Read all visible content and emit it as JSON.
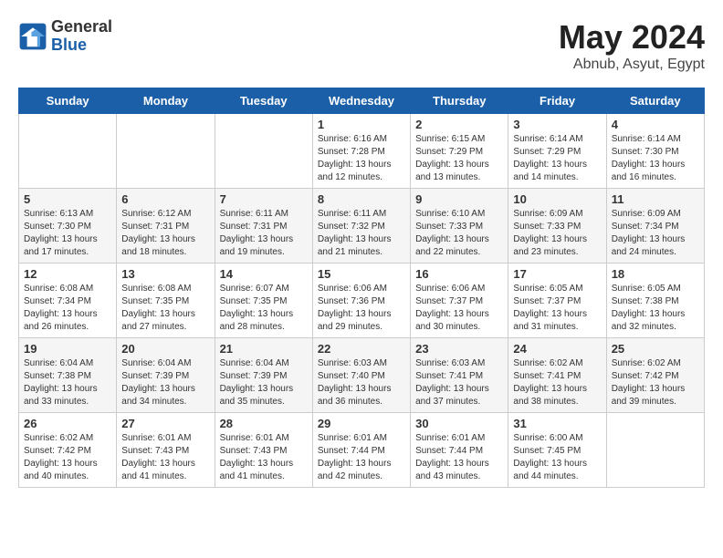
{
  "header": {
    "logo_general": "General",
    "logo_blue": "Blue",
    "month_title": "May 2024",
    "subtitle": "Abnub, Asyut, Egypt"
  },
  "weekdays": [
    "Sunday",
    "Monday",
    "Tuesday",
    "Wednesday",
    "Thursday",
    "Friday",
    "Saturday"
  ],
  "weeks": [
    [
      {
        "day": "",
        "info": ""
      },
      {
        "day": "",
        "info": ""
      },
      {
        "day": "",
        "info": ""
      },
      {
        "day": "1",
        "info": "Sunrise: 6:16 AM\nSunset: 7:28 PM\nDaylight: 13 hours\nand 12 minutes."
      },
      {
        "day": "2",
        "info": "Sunrise: 6:15 AM\nSunset: 7:29 PM\nDaylight: 13 hours\nand 13 minutes."
      },
      {
        "day": "3",
        "info": "Sunrise: 6:14 AM\nSunset: 7:29 PM\nDaylight: 13 hours\nand 14 minutes."
      },
      {
        "day": "4",
        "info": "Sunrise: 6:14 AM\nSunset: 7:30 PM\nDaylight: 13 hours\nand 16 minutes."
      }
    ],
    [
      {
        "day": "5",
        "info": "Sunrise: 6:13 AM\nSunset: 7:30 PM\nDaylight: 13 hours\nand 17 minutes."
      },
      {
        "day": "6",
        "info": "Sunrise: 6:12 AM\nSunset: 7:31 PM\nDaylight: 13 hours\nand 18 minutes."
      },
      {
        "day": "7",
        "info": "Sunrise: 6:11 AM\nSunset: 7:31 PM\nDaylight: 13 hours\nand 19 minutes."
      },
      {
        "day": "8",
        "info": "Sunrise: 6:11 AM\nSunset: 7:32 PM\nDaylight: 13 hours\nand 21 minutes."
      },
      {
        "day": "9",
        "info": "Sunrise: 6:10 AM\nSunset: 7:33 PM\nDaylight: 13 hours\nand 22 minutes."
      },
      {
        "day": "10",
        "info": "Sunrise: 6:09 AM\nSunset: 7:33 PM\nDaylight: 13 hours\nand 23 minutes."
      },
      {
        "day": "11",
        "info": "Sunrise: 6:09 AM\nSunset: 7:34 PM\nDaylight: 13 hours\nand 24 minutes."
      }
    ],
    [
      {
        "day": "12",
        "info": "Sunrise: 6:08 AM\nSunset: 7:34 PM\nDaylight: 13 hours\nand 26 minutes."
      },
      {
        "day": "13",
        "info": "Sunrise: 6:08 AM\nSunset: 7:35 PM\nDaylight: 13 hours\nand 27 minutes."
      },
      {
        "day": "14",
        "info": "Sunrise: 6:07 AM\nSunset: 7:35 PM\nDaylight: 13 hours\nand 28 minutes."
      },
      {
        "day": "15",
        "info": "Sunrise: 6:06 AM\nSunset: 7:36 PM\nDaylight: 13 hours\nand 29 minutes."
      },
      {
        "day": "16",
        "info": "Sunrise: 6:06 AM\nSunset: 7:37 PM\nDaylight: 13 hours\nand 30 minutes."
      },
      {
        "day": "17",
        "info": "Sunrise: 6:05 AM\nSunset: 7:37 PM\nDaylight: 13 hours\nand 31 minutes."
      },
      {
        "day": "18",
        "info": "Sunrise: 6:05 AM\nSunset: 7:38 PM\nDaylight: 13 hours\nand 32 minutes."
      }
    ],
    [
      {
        "day": "19",
        "info": "Sunrise: 6:04 AM\nSunset: 7:38 PM\nDaylight: 13 hours\nand 33 minutes."
      },
      {
        "day": "20",
        "info": "Sunrise: 6:04 AM\nSunset: 7:39 PM\nDaylight: 13 hours\nand 34 minutes."
      },
      {
        "day": "21",
        "info": "Sunrise: 6:04 AM\nSunset: 7:39 PM\nDaylight: 13 hours\nand 35 minutes."
      },
      {
        "day": "22",
        "info": "Sunrise: 6:03 AM\nSunset: 7:40 PM\nDaylight: 13 hours\nand 36 minutes."
      },
      {
        "day": "23",
        "info": "Sunrise: 6:03 AM\nSunset: 7:41 PM\nDaylight: 13 hours\nand 37 minutes."
      },
      {
        "day": "24",
        "info": "Sunrise: 6:02 AM\nSunset: 7:41 PM\nDaylight: 13 hours\nand 38 minutes."
      },
      {
        "day": "25",
        "info": "Sunrise: 6:02 AM\nSunset: 7:42 PM\nDaylight: 13 hours\nand 39 minutes."
      }
    ],
    [
      {
        "day": "26",
        "info": "Sunrise: 6:02 AM\nSunset: 7:42 PM\nDaylight: 13 hours\nand 40 minutes."
      },
      {
        "day": "27",
        "info": "Sunrise: 6:01 AM\nSunset: 7:43 PM\nDaylight: 13 hours\nand 41 minutes."
      },
      {
        "day": "28",
        "info": "Sunrise: 6:01 AM\nSunset: 7:43 PM\nDaylight: 13 hours\nand 41 minutes."
      },
      {
        "day": "29",
        "info": "Sunrise: 6:01 AM\nSunset: 7:44 PM\nDaylight: 13 hours\nand 42 minutes."
      },
      {
        "day": "30",
        "info": "Sunrise: 6:01 AM\nSunset: 7:44 PM\nDaylight: 13 hours\nand 43 minutes."
      },
      {
        "day": "31",
        "info": "Sunrise: 6:00 AM\nSunset: 7:45 PM\nDaylight: 13 hours\nand 44 minutes."
      },
      {
        "day": "",
        "info": ""
      }
    ]
  ]
}
